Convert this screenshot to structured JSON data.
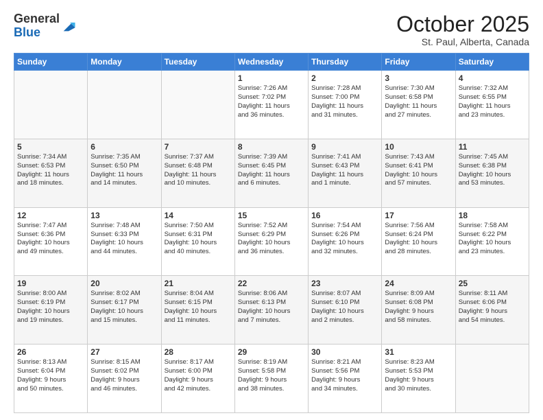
{
  "logo": {
    "general": "General",
    "blue": "Blue"
  },
  "header": {
    "month": "October 2025",
    "location": "St. Paul, Alberta, Canada"
  },
  "weekdays": [
    "Sunday",
    "Monday",
    "Tuesday",
    "Wednesday",
    "Thursday",
    "Friday",
    "Saturday"
  ],
  "weeks": [
    [
      {
        "day": "",
        "info": ""
      },
      {
        "day": "",
        "info": ""
      },
      {
        "day": "",
        "info": ""
      },
      {
        "day": "1",
        "info": "Sunrise: 7:26 AM\nSunset: 7:02 PM\nDaylight: 11 hours\nand 36 minutes."
      },
      {
        "day": "2",
        "info": "Sunrise: 7:28 AM\nSunset: 7:00 PM\nDaylight: 11 hours\nand 31 minutes."
      },
      {
        "day": "3",
        "info": "Sunrise: 7:30 AM\nSunset: 6:58 PM\nDaylight: 11 hours\nand 27 minutes."
      },
      {
        "day": "4",
        "info": "Sunrise: 7:32 AM\nSunset: 6:55 PM\nDaylight: 11 hours\nand 23 minutes."
      }
    ],
    [
      {
        "day": "5",
        "info": "Sunrise: 7:34 AM\nSunset: 6:53 PM\nDaylight: 11 hours\nand 18 minutes."
      },
      {
        "day": "6",
        "info": "Sunrise: 7:35 AM\nSunset: 6:50 PM\nDaylight: 11 hours\nand 14 minutes."
      },
      {
        "day": "7",
        "info": "Sunrise: 7:37 AM\nSunset: 6:48 PM\nDaylight: 11 hours\nand 10 minutes."
      },
      {
        "day": "8",
        "info": "Sunrise: 7:39 AM\nSunset: 6:45 PM\nDaylight: 11 hours\nand 6 minutes."
      },
      {
        "day": "9",
        "info": "Sunrise: 7:41 AM\nSunset: 6:43 PM\nDaylight: 11 hours\nand 1 minute."
      },
      {
        "day": "10",
        "info": "Sunrise: 7:43 AM\nSunset: 6:41 PM\nDaylight: 10 hours\nand 57 minutes."
      },
      {
        "day": "11",
        "info": "Sunrise: 7:45 AM\nSunset: 6:38 PM\nDaylight: 10 hours\nand 53 minutes."
      }
    ],
    [
      {
        "day": "12",
        "info": "Sunrise: 7:47 AM\nSunset: 6:36 PM\nDaylight: 10 hours\nand 49 minutes."
      },
      {
        "day": "13",
        "info": "Sunrise: 7:48 AM\nSunset: 6:33 PM\nDaylight: 10 hours\nand 44 minutes."
      },
      {
        "day": "14",
        "info": "Sunrise: 7:50 AM\nSunset: 6:31 PM\nDaylight: 10 hours\nand 40 minutes."
      },
      {
        "day": "15",
        "info": "Sunrise: 7:52 AM\nSunset: 6:29 PM\nDaylight: 10 hours\nand 36 minutes."
      },
      {
        "day": "16",
        "info": "Sunrise: 7:54 AM\nSunset: 6:26 PM\nDaylight: 10 hours\nand 32 minutes."
      },
      {
        "day": "17",
        "info": "Sunrise: 7:56 AM\nSunset: 6:24 PM\nDaylight: 10 hours\nand 28 minutes."
      },
      {
        "day": "18",
        "info": "Sunrise: 7:58 AM\nSunset: 6:22 PM\nDaylight: 10 hours\nand 23 minutes."
      }
    ],
    [
      {
        "day": "19",
        "info": "Sunrise: 8:00 AM\nSunset: 6:19 PM\nDaylight: 10 hours\nand 19 minutes."
      },
      {
        "day": "20",
        "info": "Sunrise: 8:02 AM\nSunset: 6:17 PM\nDaylight: 10 hours\nand 15 minutes."
      },
      {
        "day": "21",
        "info": "Sunrise: 8:04 AM\nSunset: 6:15 PM\nDaylight: 10 hours\nand 11 minutes."
      },
      {
        "day": "22",
        "info": "Sunrise: 8:06 AM\nSunset: 6:13 PM\nDaylight: 10 hours\nand 7 minutes."
      },
      {
        "day": "23",
        "info": "Sunrise: 8:07 AM\nSunset: 6:10 PM\nDaylight: 10 hours\nand 2 minutes."
      },
      {
        "day": "24",
        "info": "Sunrise: 8:09 AM\nSunset: 6:08 PM\nDaylight: 9 hours\nand 58 minutes."
      },
      {
        "day": "25",
        "info": "Sunrise: 8:11 AM\nSunset: 6:06 PM\nDaylight: 9 hours\nand 54 minutes."
      }
    ],
    [
      {
        "day": "26",
        "info": "Sunrise: 8:13 AM\nSunset: 6:04 PM\nDaylight: 9 hours\nand 50 minutes."
      },
      {
        "day": "27",
        "info": "Sunrise: 8:15 AM\nSunset: 6:02 PM\nDaylight: 9 hours\nand 46 minutes."
      },
      {
        "day": "28",
        "info": "Sunrise: 8:17 AM\nSunset: 6:00 PM\nDaylight: 9 hours\nand 42 minutes."
      },
      {
        "day": "29",
        "info": "Sunrise: 8:19 AM\nSunset: 5:58 PM\nDaylight: 9 hours\nand 38 minutes."
      },
      {
        "day": "30",
        "info": "Sunrise: 8:21 AM\nSunset: 5:56 PM\nDaylight: 9 hours\nand 34 minutes."
      },
      {
        "day": "31",
        "info": "Sunrise: 8:23 AM\nSunset: 5:53 PM\nDaylight: 9 hours\nand 30 minutes."
      },
      {
        "day": "",
        "info": ""
      }
    ]
  ]
}
